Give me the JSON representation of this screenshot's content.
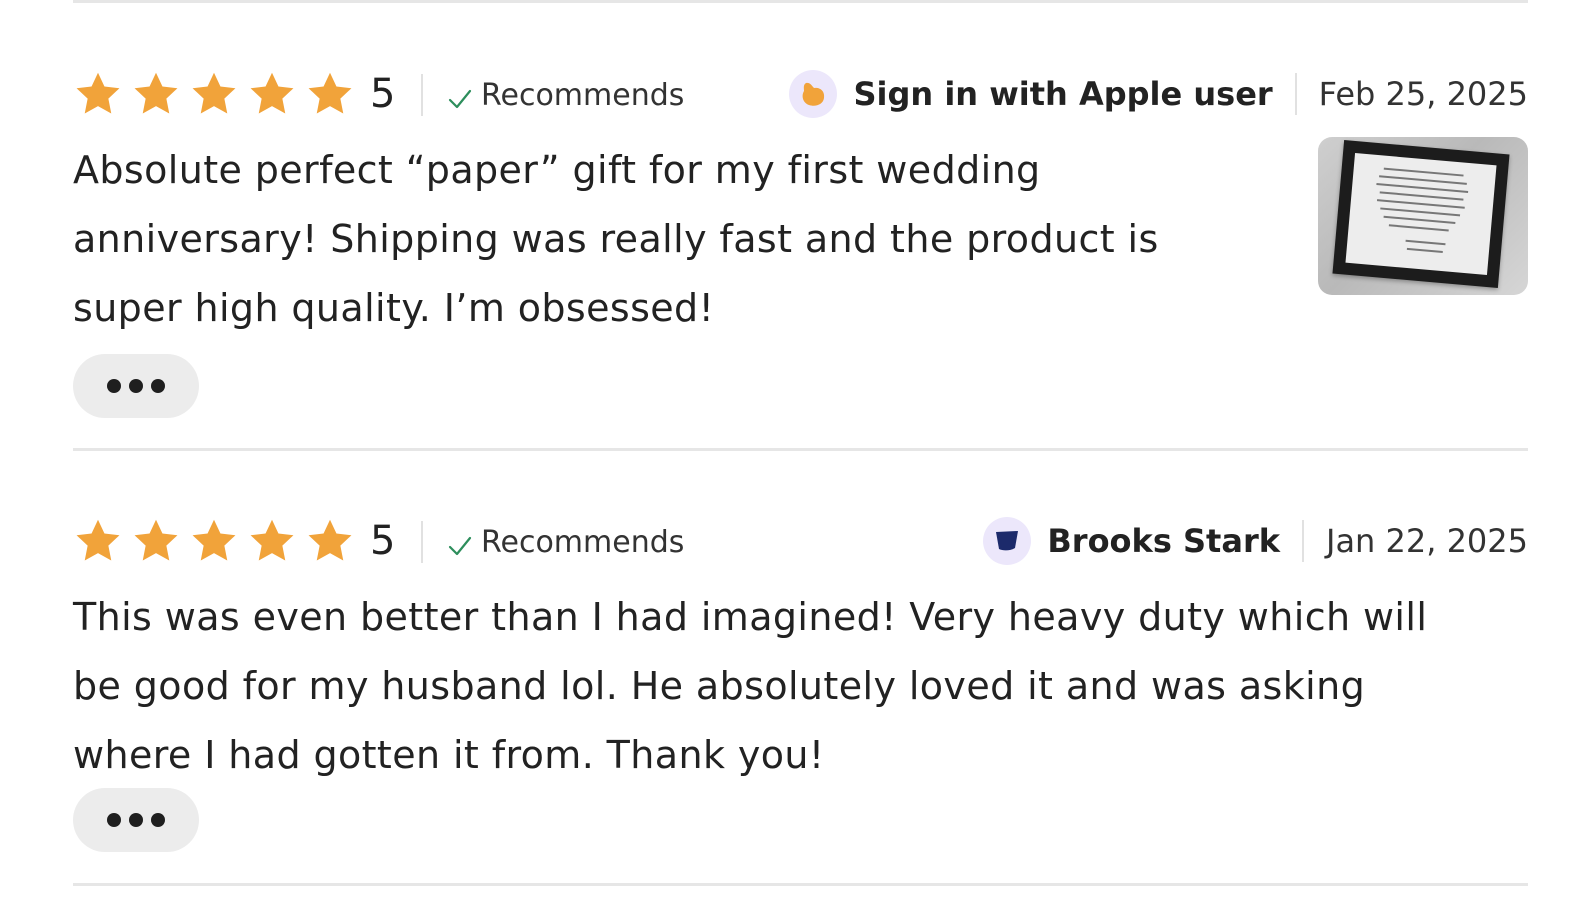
{
  "reviews": [
    {
      "stars": 5,
      "rating": "5",
      "recommends_label": "Recommends",
      "user_name": "Sign in with Apple user",
      "date": "Feb 25, 2025",
      "text": "Absolute perfect “paper” gift for my first wedding anniversary! Shipping was really fast and the product is super high quality. I’m obsessed!",
      "has_photo": true
    },
    {
      "stars": 5,
      "rating": "5",
      "recommends_label": "Recommends",
      "user_name": "Brooks Stark",
      "date": "Jan 22, 2025",
      "text": "This was even better than I had imagined! Very heavy duty which will be good for my husband lol. He absolutely loved it and was asking where I had gotten it from. Thank you!",
      "has_photo": false
    }
  ],
  "colors": {
    "star": "#f1a33a",
    "check": "#2d8e5c",
    "avatar_bg": "#ece7fb",
    "avatar1_icon": "#f1a33a",
    "avatar2_icon": "#1c2a6b",
    "divider": "#e6e6e6",
    "more_button_bg": "#ececec"
  },
  "icons": {
    "star": "star-icon",
    "check": "check-icon",
    "more": "ellipsis-icon",
    "avatar1": "avatar-orange-icon",
    "avatar2": "avatar-navy-icon"
  }
}
